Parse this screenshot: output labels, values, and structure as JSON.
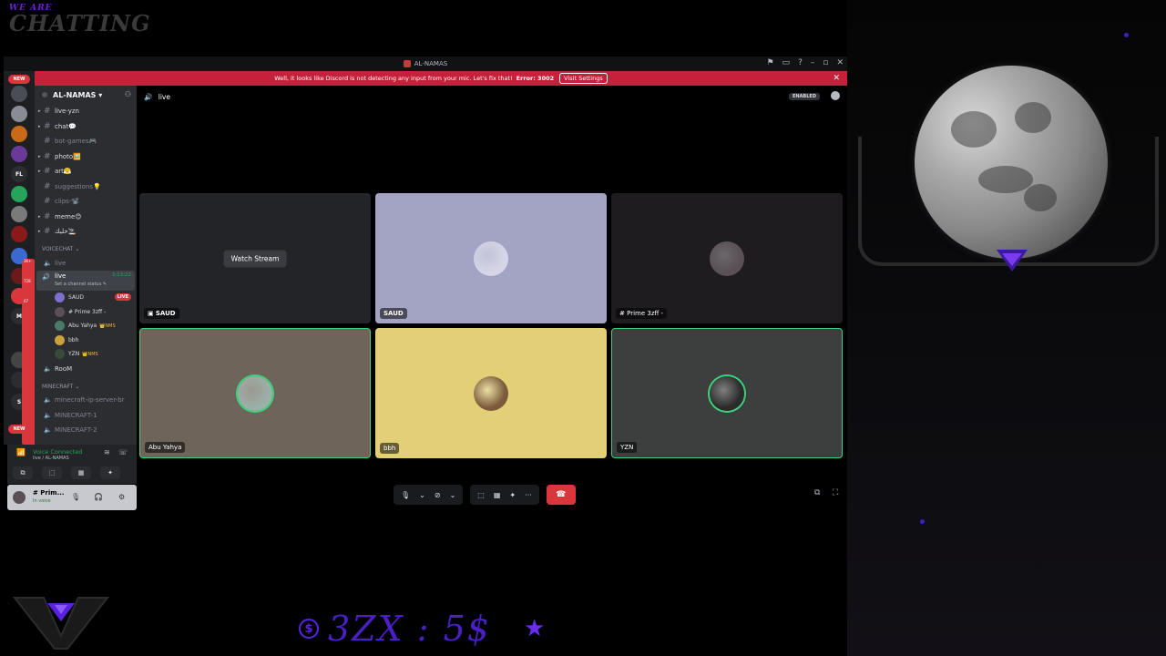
{
  "overlay": {
    "title_small": "WE ARE",
    "title_big": "CHATTING",
    "price_text": "3ZX : 5$",
    "coin_symbol": "$",
    "star": "★"
  },
  "window": {
    "title": "AL-NAMAS",
    "controls": [
      "⚑",
      "▭",
      "?",
      "–",
      "▫",
      "✕"
    ]
  },
  "notice": {
    "text": "Well, it looks like Discord is not detecting any input from your mic. Let's fix that!",
    "error": "Error: 3002",
    "button": "Visit Settings",
    "close": "✕"
  },
  "guilds": {
    "new_badge": "NEW",
    "items": [
      {
        "label": "",
        "color": "#4a4d55"
      },
      {
        "label": "",
        "color": "#8a8d94"
      },
      {
        "label": "",
        "color": "#c86a1a"
      },
      {
        "label": "",
        "color": "#6a3a9a"
      },
      {
        "label": "FL",
        "color": "#2b2d31"
      },
      {
        "label": "",
        "color": "#23a55a"
      },
      {
        "label": "",
        "color": "#7a7a7a"
      },
      {
        "label": "",
        "color": "#8a1a1a"
      },
      {
        "label": "",
        "color": "#3a6acf"
      },
      {
        "label": "",
        "color": "#6a1a1a"
      },
      {
        "label": "",
        "color": "#da373c"
      },
      {
        "label": "M",
        "color": "#2b2d31"
      },
      {
        "label": "",
        "color": "#1e1f22"
      },
      {
        "label": "",
        "color": "#444"
      },
      {
        "label": "",
        "color": "#2b2d31"
      },
      {
        "label": "S",
        "color": "#2b2d31"
      }
    ],
    "badges": [
      "3K+",
      "728",
      "67"
    ]
  },
  "sidebar": {
    "server_name": "AL-NAMAS ▾",
    "text_channels": [
      {
        "name": "live-yzn",
        "dim": false
      },
      {
        "name": "chat💬",
        "dim": false
      },
      {
        "name": "bot-games🎮",
        "dim": true
      },
      {
        "name": "photo🖼️",
        "dim": false
      },
      {
        "name": "art😤",
        "dim": false
      },
      {
        "name": "suggestions💡",
        "dim": true
      },
      {
        "name": "clips-📽️",
        "dim": true
      },
      {
        "name": "meme😊",
        "dim": false
      },
      {
        "name": "خليك🚬",
        "dim": false
      }
    ],
    "voice_category": "VOICECHAT ⌄",
    "voice_live_idle": "live",
    "live_channel": {
      "name": "live",
      "status": "Set a channel status ✎",
      "time": "3:13:22"
    },
    "voice_users": [
      {
        "name": "SAUD",
        "live": "LIVE",
        "tag": "",
        "color": "#7c6fd0"
      },
      {
        "name": "# Prime 3zff -",
        "live": "",
        "tag": "",
        "color": "#5a4f55"
      },
      {
        "name": "Abu Yahya",
        "live": "",
        "tag": "👑NMS",
        "color": "#4a7a6a"
      },
      {
        "name": "bbh",
        "live": "",
        "tag": "",
        "color": "#c9a23a"
      },
      {
        "name": "YZN",
        "live": "",
        "tag": "👑NMS",
        "color": "#3a4a3a"
      }
    ],
    "room": "RooM",
    "minecraft_category": "MINECRAFT ⌄",
    "minecraft_channels": [
      "minecraft-ip-server-br",
      "MINECRAFT-1",
      "MINECRAFT-2"
    ]
  },
  "voice_panel": {
    "status": "Voice Connected",
    "sub": "live / AL-NAMAS",
    "buttons": [
      "⧉",
      "⬚",
      "▦",
      "✦"
    ]
  },
  "user_panel": {
    "name": "# Prim...",
    "status": "In voice"
  },
  "main": {
    "channel_title": "live",
    "enabled_label": "ENABLED",
    "watch_stream": "Watch Stream",
    "tiles": [
      {
        "label": "SAUD",
        "bg": "#232428",
        "avatar": "",
        "bold": true,
        "speaking": false,
        "stream": true
      },
      {
        "label": "SAUD",
        "bg": "#a3a3c4",
        "avatar": "#d6d6e8",
        "bold": true,
        "speaking": false,
        "stream": false
      },
      {
        "label": "# Prime 3zff -",
        "bg": "#1e1c1f",
        "avatar": "#5a4f55",
        "bold": false,
        "speaking": false,
        "stream": false
      },
      {
        "label": "Abu Yahya",
        "bg": "#6e6459",
        "avatar": "#9ab0a8",
        "bold": false,
        "speaking": true,
        "stream": false
      },
      {
        "label": "bbh",
        "bg": "#e3cf78",
        "avatar": "#7a5a3a",
        "bold": false,
        "speaking": false,
        "stream": false
      },
      {
        "label": "YZN",
        "bg": "#3d3f3e",
        "avatar": "#2a2a2a",
        "bold": false,
        "speaking": true,
        "stream": false
      }
    ]
  },
  "call_controls": {
    "mic": "🎙",
    "cam": "⊘",
    "screen": "⬚",
    "activities": "▦",
    "soundboard": "✦",
    "more": "···",
    "hangup": "☎",
    "popout": "⧉",
    "fullscreen": "⛶"
  }
}
